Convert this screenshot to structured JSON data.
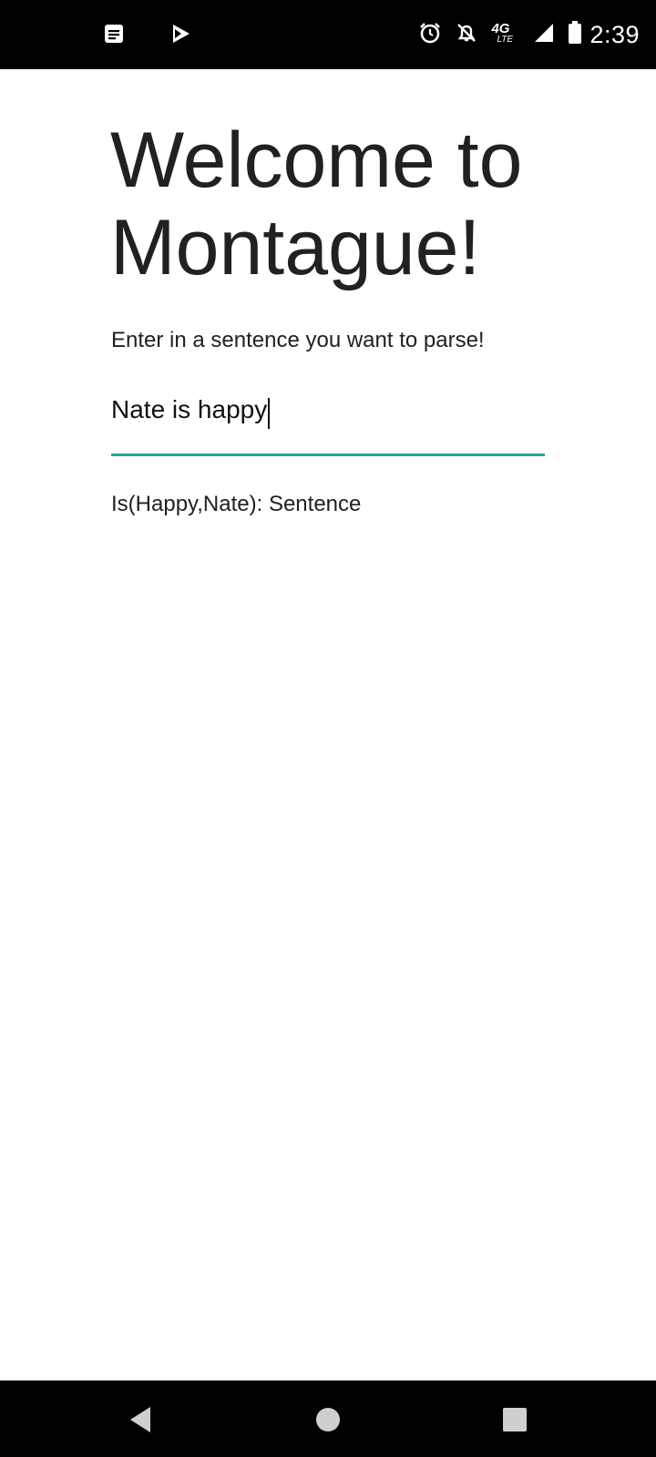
{
  "status_bar": {
    "time": "2:39",
    "left_icons": [
      "notes-icon",
      "play-store-icon"
    ],
    "right_icons": [
      "alarm-icon",
      "notifications-off-icon",
      "network-4g-lte-icon",
      "signal-icon",
      "battery-icon"
    ],
    "network_label": "4G",
    "network_sub": "LTE"
  },
  "main": {
    "title": "Welcome to Montague!",
    "prompt": "Enter in a sentence you want to parse!",
    "input": {
      "value": "Nate is happy"
    },
    "result": "Is(Happy,Nate): Sentence"
  },
  "colors": {
    "accent": "#26a69a",
    "status_bar": "#000000",
    "nav_bar": "#000000",
    "text": "#212121"
  },
  "nav_bar": {
    "buttons": [
      "back-icon",
      "home-icon",
      "recents-icon"
    ]
  }
}
